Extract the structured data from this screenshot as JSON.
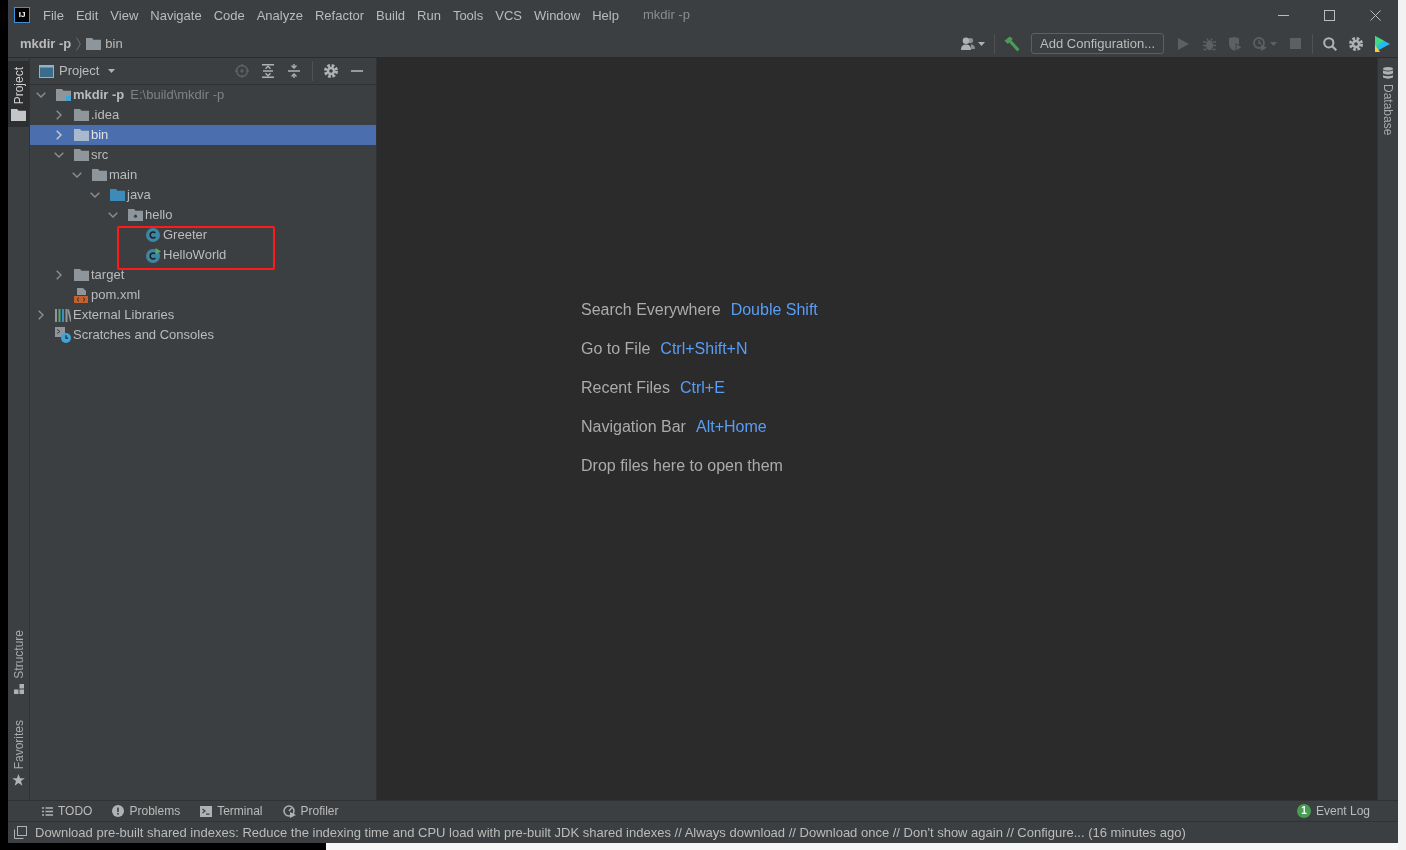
{
  "window": {
    "logo_text": "IJ",
    "title": "mkdir -p"
  },
  "menu": [
    "File",
    "Edit",
    "View",
    "Navigate",
    "Code",
    "Analyze",
    "Refactor",
    "Build",
    "Run",
    "Tools",
    "VCS",
    "Window",
    "Help"
  ],
  "breadcrumbs": [
    {
      "kind": "project",
      "label": "mkdir -p"
    },
    {
      "kind": "folder",
      "label": "bin"
    }
  ],
  "toolbar": [
    {
      "kind": "user",
      "disabled": false
    },
    {
      "kind": "separator"
    },
    {
      "kind": "build",
      "disabled": false
    },
    {
      "kind": "configuration",
      "label": "Add Configuration...",
      "disabled": false
    },
    {
      "kind": "run",
      "disabled": true
    },
    {
      "kind": "debug",
      "disabled": true
    },
    {
      "kind": "coverage",
      "disabled": true
    },
    {
      "kind": "profile",
      "disabled": true
    },
    {
      "kind": "stop",
      "disabled": true
    },
    {
      "kind": "separator"
    },
    {
      "kind": "search",
      "disabled": false
    },
    {
      "kind": "settings",
      "disabled": false
    },
    {
      "kind": "toolbox",
      "disabled": false
    }
  ],
  "left_strip": {
    "top": [
      {
        "kind": "project",
        "label": "Project",
        "selected": true
      }
    ],
    "bottom": [
      {
        "kind": "structure",
        "label": "Structure",
        "selected": false
      },
      {
        "kind": "favorites",
        "label": "Favorites",
        "selected": false
      }
    ]
  },
  "project": {
    "title": "Project",
    "tools": [
      {
        "kind": "locate",
        "disabled": true
      },
      {
        "kind": "expand-all",
        "disabled": false
      },
      {
        "kind": "collapse-all",
        "disabled": false
      },
      {
        "kind": "separator"
      },
      {
        "kind": "settings",
        "disabled": false
      },
      {
        "kind": "hide",
        "disabled": false
      }
    ],
    "tree": [
      {
        "kind": "module",
        "label": "mkdir -p",
        "path": "E:\\build\\mkdir -p",
        "expanded": true,
        "selected": false,
        "highlighted": false,
        "children": [
          {
            "kind": "folder",
            "label": ".idea",
            "expanded": false,
            "selected": false,
            "highlighted": false
          },
          {
            "kind": "folder",
            "label": "bin",
            "expanded": false,
            "selected": true,
            "highlighted": false
          },
          {
            "kind": "folder",
            "label": "src",
            "expanded": true,
            "selected": false,
            "highlighted": false,
            "children": [
              {
                "kind": "folder",
                "label": "main",
                "expanded": true,
                "selected": false,
                "highlighted": false,
                "children": [
                  {
                    "kind": "source-folder",
                    "label": "java",
                    "expanded": true,
                    "selected": false,
                    "highlighted": false,
                    "children": [
                      {
                        "kind": "package",
                        "label": "hello",
                        "expanded": true,
                        "selected": false,
                        "highlighted": false,
                        "children": [
                          {
                            "kind": "class",
                            "label": "Greeter",
                            "selected": false,
                            "highlighted": true
                          },
                          {
                            "kind": "main-class",
                            "label": "HelloWorld",
                            "selected": false,
                            "highlighted": true
                          }
                        ]
                      }
                    ]
                  }
                ]
              }
            ]
          },
          {
            "kind": "folder",
            "label": "target",
            "expanded": false,
            "selected": false,
            "highlighted": false
          },
          {
            "kind": "maven",
            "label": "pom.xml",
            "selected": false,
            "highlighted": false
          }
        ]
      },
      {
        "kind": "libraries",
        "label": "External Libraries",
        "expanded": false,
        "selected": false,
        "highlighted": false
      },
      {
        "kind": "scratches",
        "label": "Scratches and Consoles",
        "selected": false,
        "highlighted": false
      }
    ]
  },
  "editor": {
    "hints": [
      {
        "label": "Search Everywhere",
        "shortcut": "Double Shift"
      },
      {
        "label": "Go to File",
        "shortcut": "Ctrl+Shift+N"
      },
      {
        "label": "Recent Files",
        "shortcut": "Ctrl+E"
      },
      {
        "label": "Navigation Bar",
        "shortcut": "Alt+Home"
      },
      {
        "label": "Drop files here to open them"
      }
    ]
  },
  "right_strip": [
    {
      "kind": "database",
      "label": "Database",
      "selected": false
    }
  ],
  "bottom_tabs": {
    "left": [
      {
        "kind": "todo",
        "label": "TODO",
        "selected": false
      },
      {
        "kind": "problems",
        "label": "Problems",
        "selected": false
      },
      {
        "kind": "terminal",
        "label": "Terminal",
        "selected": false
      },
      {
        "kind": "profiler",
        "label": "Profiler",
        "selected": false
      }
    ],
    "right": [
      {
        "label": "Event Log",
        "badge": "1",
        "selected": false
      }
    ]
  },
  "status_bar": {
    "message": "Download pre-built shared indexes: Reduce the indexing time and CPU load with pre-built JDK shared indexes // Always download // Download once // Don't show again // Configure... (16 minutes ago)"
  }
}
